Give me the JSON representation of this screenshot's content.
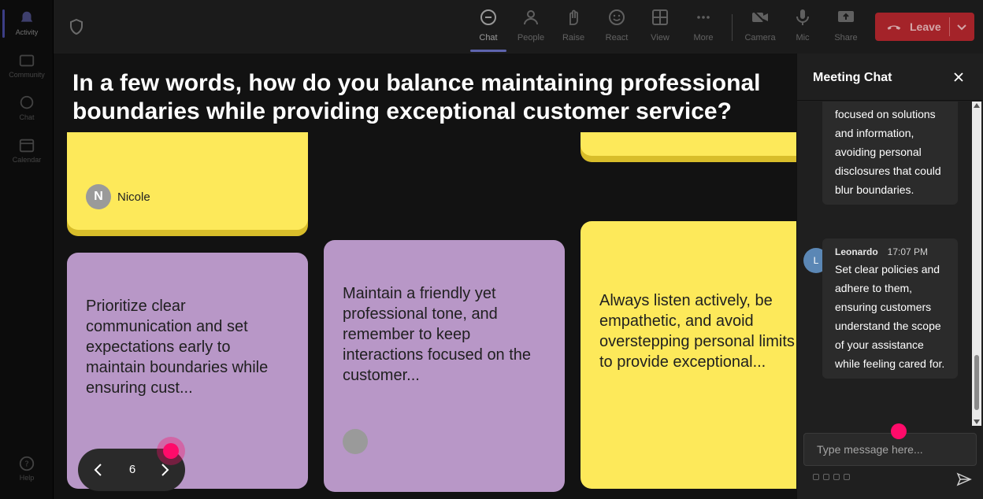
{
  "rail": {
    "items": [
      {
        "label": "Activity",
        "icon": "bell-icon"
      },
      {
        "label": "Community",
        "icon": "community-icon"
      },
      {
        "label": "Chat",
        "icon": "chat-icon"
      },
      {
        "label": "Calendar",
        "icon": "calendar-icon"
      },
      {
        "label": "Help",
        "icon": "help-icon"
      }
    ]
  },
  "toolbar": {
    "buttons": [
      {
        "label": "Chat",
        "icon": "chat-icon"
      },
      {
        "label": "People",
        "icon": "people-icon"
      },
      {
        "label": "Raise",
        "icon": "hand-icon"
      },
      {
        "label": "React",
        "icon": "smiley-icon"
      },
      {
        "label": "View",
        "icon": "grid-icon"
      },
      {
        "label": "More",
        "icon": "more-icon"
      },
      {
        "label": "Camera",
        "icon": "camera-off-icon"
      },
      {
        "label": "Mic",
        "icon": "mic-icon"
      },
      {
        "label": "Share",
        "icon": "share-icon"
      }
    ],
    "leave_label": "Leave"
  },
  "board": {
    "question": "In a few words, how do you balance maintaining professional boundaries while providing exceptional customer service?",
    "cards": [
      {
        "author_initial": "N",
        "author_name": "Nicole"
      },
      {
        "text": "Prioritize clear communication and set expectations early to maintain boundaries while ensuring cust..."
      },
      {
        "text": "Maintain a friendly yet professional tone, and remember to keep interactions focused on the customer..."
      },
      {
        "text": "Always listen actively, be empathetic, and avoid overstepping personal limits to provide exceptional..."
      }
    ],
    "page_number": "6"
  },
  "chat": {
    "title": "Meeting Chat",
    "messages": [
      {
        "text": "focused on solutions and information, avoiding personal disclosures that could blur boundaries."
      },
      {
        "author": "Leonardo",
        "time": "17:07 PM",
        "initial": "L",
        "text": "Set clear policies and adhere to them, ensuring customers understand the scope of your assistance while feeling cared for."
      }
    ],
    "input_placeholder": "Type message here..."
  },
  "colors": {
    "yellow_card": "#fde95a",
    "purple_card": "#b897c7",
    "leave_red": "#b3242b",
    "cursor_pink": "#ff0b6a"
  }
}
